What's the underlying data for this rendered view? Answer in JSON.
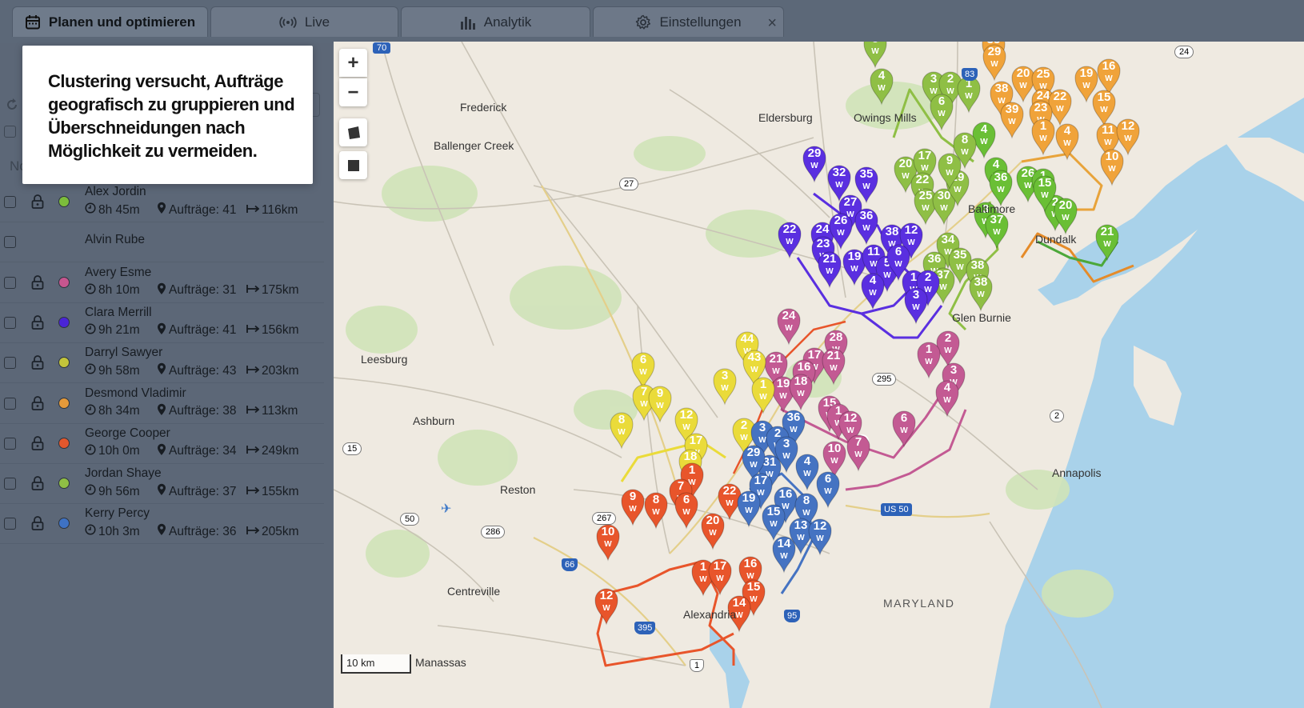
{
  "tabs": [
    {
      "label": "Planen und optimieren",
      "icon": "calendar-icon",
      "active": true
    },
    {
      "label": "Live",
      "icon": "broadcast-icon",
      "active": false
    },
    {
      "label": "Analytik",
      "icon": "bar-chart-icon",
      "active": false
    },
    {
      "label": "Einstellungen",
      "icon": "gear-icon",
      "active": false
    }
  ],
  "close_symbol": "×",
  "tooltip": {
    "text": "Clustering versucht, Aufträge geografisch zu gruppieren und Überschneidungen nach Möglichkeit zu vermeiden."
  },
  "sidebar": {
    "hidden_header": "No",
    "drivers": [
      {
        "name": "Alex Jordin",
        "time": "8h 45m",
        "orders": "Aufträge: 41",
        "distance": "116km",
        "color": "#7cbd3b"
      },
      {
        "name": "Alvin Rube",
        "time": "",
        "orders": "",
        "distance": "",
        "color": ""
      },
      {
        "name": "Avery Esme",
        "time": "8h 10m",
        "orders": "Aufträge: 31",
        "distance": "175km",
        "color": "#c7568f"
      },
      {
        "name": "Clara Merrill",
        "time": "9h 21m",
        "orders": "Aufträge: 41",
        "distance": "156km",
        "color": "#4a24d6"
      },
      {
        "name": "Darryl Sawyer",
        "time": "9h 58m",
        "orders": "Aufträge: 43",
        "distance": "203km",
        "color": "#c3c53b"
      },
      {
        "name": "Desmond Vladimir",
        "time": "8h 34m",
        "orders": "Aufträge: 38",
        "distance": "113km",
        "color": "#e59a3a"
      },
      {
        "name": "George Cooper",
        "time": "10h 0m",
        "orders": "Aufträge: 34",
        "distance": "249km",
        "color": "#e2572d"
      },
      {
        "name": "Jordan Shaye",
        "time": "9h 56m",
        "orders": "Aufträge: 37",
        "distance": "155km",
        "color": "#8fbf45"
      },
      {
        "name": "Kerry Percy",
        "time": "10h 3m",
        "orders": "Aufträge: 36",
        "distance": "205km",
        "color": "#3e72c4"
      }
    ]
  },
  "map": {
    "zoom_in": "+",
    "zoom_out": "−",
    "scale": "10 km",
    "places": [
      "Frederick",
      "Eldersburg",
      "Owings Mills",
      "Ballenger Creek",
      "Leesburg",
      "Ashburn",
      "Reston",
      "Centreville",
      "Manassas",
      "Alexandria",
      "Annapolis",
      "MARYLAND",
      "Glen Burnie",
      "Baltimore",
      "Dundalk"
    ],
    "shields": [
      "70",
      "83",
      "24",
      "27",
      "295",
      "15",
      "2",
      "50",
      "267",
      "286",
      "66",
      "395",
      "95",
      "1",
      "US 50"
    ],
    "colors": {
      "green": "#6abf35",
      "olive": "#8fbf45",
      "orange": "#f0a33a",
      "purple": "#5a2fe0",
      "pink": "#c35a93",
      "yellow": "#eadb3a",
      "red": "#e8552b",
      "blue": "#4573c2"
    },
    "markers": {
      "green": [
        "4",
        "4",
        "3",
        "36",
        "26",
        "1",
        "2",
        "20",
        "21",
        "37",
        "15"
      ],
      "olive": [
        "5",
        "4",
        "3",
        "2",
        "1",
        "6",
        "8",
        "20",
        "17",
        "22",
        "25",
        "30",
        "29",
        "9",
        "34",
        "36",
        "37",
        "35",
        "38",
        "38"
      ],
      "orange": [
        "35",
        "29",
        "20",
        "25",
        "19",
        "16",
        "38",
        "24",
        "22",
        "15",
        "39",
        "23",
        "1",
        "4",
        "11",
        "12",
        "10"
      ],
      "purple": [
        "29",
        "32",
        "35",
        "27",
        "24",
        "26",
        "36",
        "38",
        "12",
        "22",
        "23",
        "21",
        "19",
        "11",
        "5",
        "6",
        "4",
        "1",
        "2",
        "3"
      ],
      "pink": [
        "24",
        "21",
        "28",
        "17",
        "21",
        "16",
        "19",
        "18",
        "15",
        "1",
        "12",
        "10",
        "7",
        "6",
        "2",
        "1",
        "3",
        "4"
      ],
      "yellow": [
        "44",
        "43",
        "3",
        "1",
        "6",
        "7",
        "9",
        "12",
        "8",
        "17",
        "18",
        "2"
      ],
      "red": [
        "1",
        "7",
        "22",
        "9",
        "8",
        "6",
        "20",
        "10",
        "12",
        "1",
        "17",
        "16",
        "15",
        "14"
      ],
      "blue": [
        "36",
        "3",
        "2",
        "3",
        "4",
        "31",
        "29",
        "17",
        "6",
        "16",
        "19",
        "8",
        "15",
        "13",
        "12",
        "14"
      ]
    },
    "marker_suffix": "W"
  }
}
